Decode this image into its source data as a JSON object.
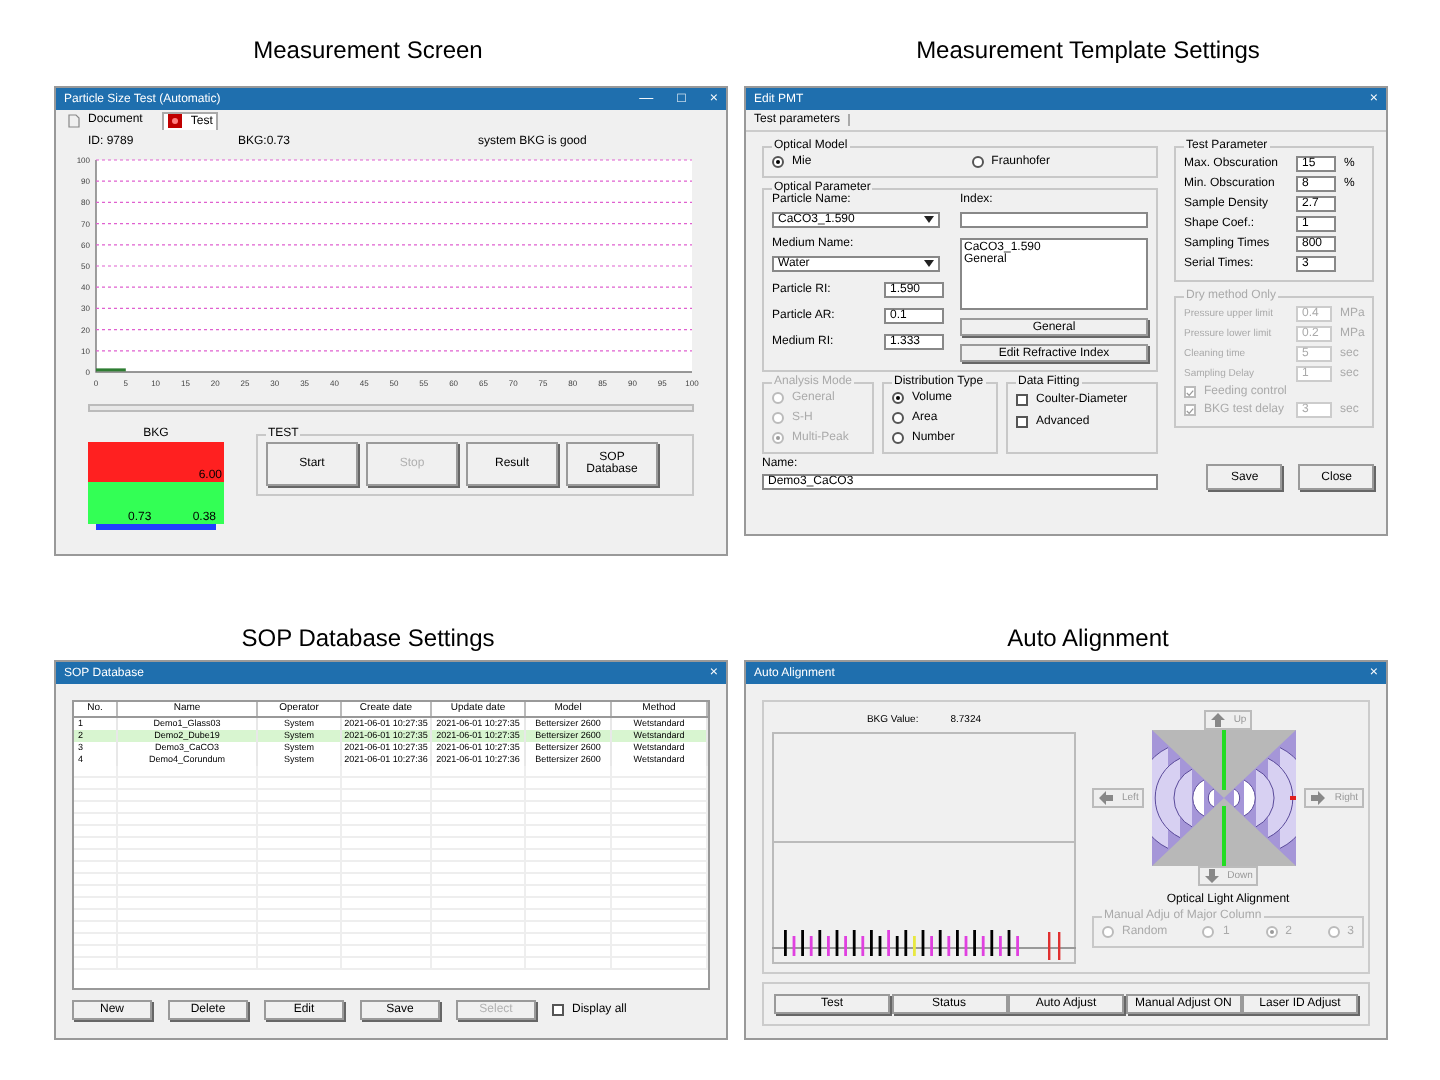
{
  "headings": [
    "Measurement Screen",
    "Measurement Template Settings",
    "SOP Database Settings",
    "Auto Alignment"
  ],
  "measurement": {
    "title": "Particle Size Test (Automatic)",
    "controls": [
      "—",
      "□",
      "×"
    ],
    "tabs": [
      {
        "label": "Document",
        "selected": false,
        "kind": "document"
      },
      {
        "label": "Test",
        "selected": true,
        "kind": "test"
      }
    ],
    "id_label": "ID: 9789",
    "bkg_label": "BKG:0.73",
    "status": "system BKG is good",
    "chart_data": {
      "type": "line",
      "x": [
        0,
        5
      ],
      "series": [
        {
          "color": "#2e7d32",
          "values": [
            1,
            1
          ]
        }
      ],
      "xlim": [
        0,
        100
      ],
      "ylim": [
        0,
        100
      ],
      "grid": true,
      "xticks": [
        0,
        5,
        10,
        15,
        20,
        25,
        30,
        35,
        40,
        45,
        50,
        55,
        60,
        65,
        70,
        75,
        80,
        85,
        90,
        95,
        100
      ],
      "yticks": [
        0,
        10,
        20,
        30,
        40,
        50,
        60,
        70,
        80,
        90,
        100
      ]
    },
    "meter": {
      "title": "BKG",
      "upper": "6.00",
      "value": "0.73",
      "lower": "0.38"
    },
    "test_group": "TEST",
    "buttons": [
      {
        "label": "Start",
        "disabled": false
      },
      {
        "label": "Stop",
        "disabled": true
      },
      {
        "label": "Result",
        "disabled": false
      },
      {
        "label": "SOP Database",
        "disabled": false
      }
    ]
  },
  "template": {
    "title": "Edit PMT",
    "close": "×",
    "tab": "Test parameters",
    "optical_model": {
      "title": "Optical Model",
      "options": [
        {
          "label": "Mie",
          "selected": true
        },
        {
          "label": "Fraunhofer",
          "selected": false
        }
      ]
    },
    "optical_parameter": {
      "title": "Optical Parameter",
      "particle_name_label": "Particle Name:",
      "particle_name": "CaCO3_1.590",
      "index_label": "Index:",
      "medium_name_label": "Medium Name:",
      "medium_name": "Water",
      "index_list": [
        "CaCO3_1.590",
        "General"
      ],
      "values": [
        {
          "label": "Particle RI:",
          "value": "1.590"
        },
        {
          "label": "Particle AR:",
          "value": "0.1"
        },
        {
          "label": "Medium RI:",
          "value": "1.333"
        }
      ],
      "buttons": [
        "General",
        "Edit Refractive Index"
      ]
    },
    "analysis_mode": {
      "title": "Analysis Mode",
      "disabled": true,
      "options": [
        {
          "label": "General",
          "selected": false
        },
        {
          "label": "S-H",
          "selected": false
        },
        {
          "label": "Multi-Peak",
          "selected": true
        }
      ]
    },
    "distribution_type": {
      "title": "Distribution Type",
      "disabled": false,
      "options": [
        {
          "label": "Volume",
          "selected": true
        },
        {
          "label": "Area",
          "selected": false
        },
        {
          "label": "Number",
          "selected": false
        }
      ]
    },
    "data_fitting": {
      "title": "Data Fitting",
      "options": [
        {
          "label": "Coulter-Diameter",
          "checked": false
        },
        {
          "label": "Advanced",
          "checked": false
        }
      ]
    },
    "name_label": "Name:",
    "name": "Demo3_CaCO3",
    "test_parameter": {
      "title": "Test Parameter",
      "rows": [
        {
          "label": "Max. Obscuration",
          "value": "15",
          "unit": "%"
        },
        {
          "label": "Min. Obscuration",
          "value": "8",
          "unit": "%"
        },
        {
          "label": "Sample Density",
          "value": "2.7"
        },
        {
          "label": "Shape Coef.:",
          "value": "1"
        },
        {
          "label": "Sampling Times",
          "value": "800"
        },
        {
          "label": "Serial Times:",
          "value": "3"
        }
      ]
    },
    "dry_method": {
      "title": "Dry method Only",
      "disabled": true,
      "rows": [
        {
          "kind": "field",
          "label": "Pressure upper limit",
          "value": "0.4",
          "unit": "MPa"
        },
        {
          "kind": "field",
          "label": "Pressure lower limit",
          "value": "0.2",
          "unit": "MPa"
        },
        {
          "kind": "field",
          "label": "Cleaning time",
          "value": "5",
          "unit": "sec"
        },
        {
          "kind": "field",
          "label": "Sampling Delay",
          "value": "1",
          "unit": "sec"
        },
        {
          "kind": "check",
          "label": "Feeding control",
          "checked": true
        },
        {
          "kind": "checkfield",
          "label": "BKG test delay",
          "checked": true,
          "value": "3",
          "unit": "sec"
        }
      ]
    },
    "buttons": [
      "Save",
      "Close"
    ]
  },
  "sop": {
    "title": "SOP Database",
    "close": "×",
    "columns": [
      "No.",
      "Name",
      "Operator",
      "Create date",
      "Update date",
      "Model",
      "Method"
    ],
    "rows": [
      {
        "selected": false,
        "cells": [
          "1",
          "Demo1_Glass03",
          "System",
          "2021-06-01 10:27:35",
          "2021-06-01 10:27:35",
          "Bettersizer 2600",
          "Wetstandard"
        ]
      },
      {
        "selected": true,
        "cells": [
          "2",
          "Demo2_Dube19",
          "System",
          "2021-06-01 10:27:35",
          "2021-06-01 10:27:35",
          "Bettersizer 2600",
          "Wetstandard"
        ]
      },
      {
        "selected": false,
        "cells": [
          "3",
          "Demo3_CaCO3",
          "System",
          "2021-06-01 10:27:35",
          "2021-06-01 10:27:35",
          "Bettersizer 2600",
          "Wetstandard"
        ]
      },
      {
        "selected": false,
        "cells": [
          "4",
          "Demo4_Corundum",
          "System",
          "2021-06-01 10:27:36",
          "2021-06-01 10:27:36",
          "Bettersizer 2600",
          "Wetstandard"
        ]
      }
    ],
    "buttons": [
      {
        "label": "New",
        "disabled": false
      },
      {
        "label": "Delete",
        "disabled": false
      },
      {
        "label": "Edit",
        "disabled": false
      },
      {
        "label": "Save",
        "disabled": false
      },
      {
        "label": "Select",
        "disabled": true
      }
    ],
    "display_all": {
      "label": "Display all",
      "checked": false
    }
  },
  "alignment": {
    "title": "Auto Alignment",
    "close": "×",
    "bkg_label": "BKG Value:",
    "bkg_value": "8.7324",
    "arrows": [
      {
        "kind": "up",
        "label": "Up"
      },
      {
        "kind": "left",
        "label": "Left"
      },
      {
        "kind": "right",
        "label": "Right"
      },
      {
        "kind": "down",
        "label": "Down"
      }
    ],
    "caption": "Optical Light Alignment",
    "manual_group": {
      "title": "Manual Adju of Major Column",
      "disabled": true,
      "options": [
        {
          "label": "Random",
          "selected": false
        },
        {
          "label": "1",
          "selected": false
        },
        {
          "label": "2",
          "selected": true
        },
        {
          "label": "3",
          "selected": false
        }
      ]
    },
    "buttons": [
      "Test",
      "Status",
      "Auto Adjust",
      "Manual Adjust ON",
      "Laser ID Adjust"
    ]
  }
}
